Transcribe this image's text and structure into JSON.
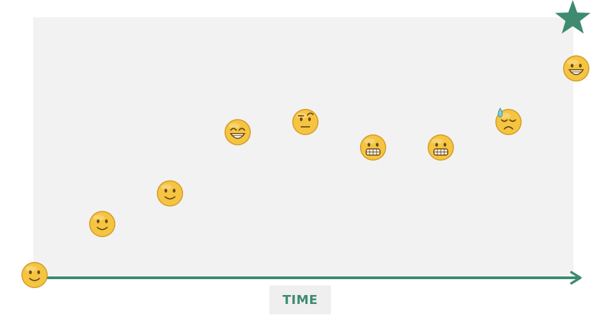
{
  "axis": {
    "label": "TIME"
  },
  "colors": {
    "accent": "#3e8b70",
    "panel": "#f2f2f2",
    "label_box": "#efefef",
    "face_fill": "#f5c542",
    "face_edge": "#d49a22",
    "feature": "#6b4a12",
    "sweat": "#7fd0d8"
  },
  "goal": {
    "icon": "star-icon"
  },
  "journey": [
    {
      "step": 0,
      "level": 0.0,
      "mood": "slightly-smiling-face-icon"
    },
    {
      "step": 1,
      "level": 0.2,
      "mood": "slightly-smiling-face-icon"
    },
    {
      "step": 2,
      "level": 0.32,
      "mood": "slightly-smiling-face-icon"
    },
    {
      "step": 3,
      "level": 0.56,
      "mood": "beaming-face-icon"
    },
    {
      "step": 4,
      "level": 0.6,
      "mood": "face-with-raised-eyebrow-icon"
    },
    {
      "step": 5,
      "level": 0.5,
      "mood": "grimacing-face-icon"
    },
    {
      "step": 6,
      "level": 0.5,
      "mood": "grimacing-face-icon"
    },
    {
      "step": 7,
      "level": 0.6,
      "mood": "downcast-face-with-sweat-icon"
    },
    {
      "step": 8,
      "level": 0.81,
      "mood": "grinning-face-icon"
    }
  ]
}
